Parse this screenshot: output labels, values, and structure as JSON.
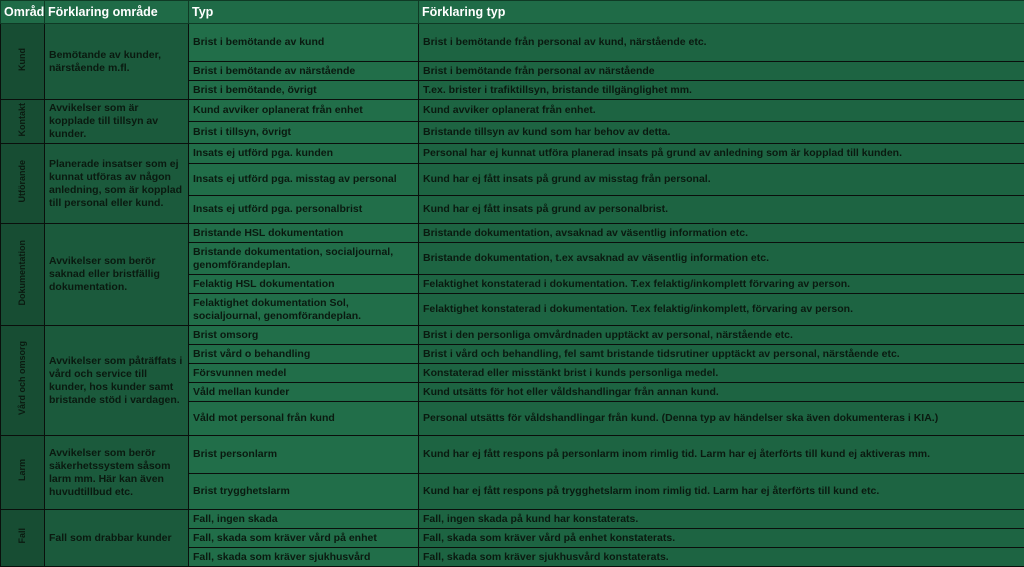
{
  "headers": {
    "omrade": "Område",
    "forklaring_omrade": "Förklaring område",
    "typ": "Typ",
    "forklaring_typ": "Förklaring typ"
  },
  "groups": [
    {
      "area": "Kund",
      "explanation": "Bemötande av kunder, närstående m.fl.",
      "rows": [
        {
          "typ": "Brist i bemötande av kund",
          "forklaring": "Brist i bemötande från personal av kund, närstående etc."
        },
        {
          "typ": "Brist i bemötande av närstående",
          "forklaring": "Brist i bemötande från personal av närstående"
        },
        {
          "typ": "Brist i bemötande, övrigt",
          "forklaring": "T.ex. brister i trafiktillsyn, bristande tillgänglighet mm."
        }
      ]
    },
    {
      "area": "Kontakt",
      "explanation": "Avvikelser som är kopplade till tillsyn av kunder.",
      "rows": [
        {
          "typ": "Kund avviker oplanerat från enhet",
          "forklaring": "Kund avviker oplanerat från enhet."
        },
        {
          "typ": "Brist i tillsyn, övrigt",
          "forklaring": "Bristande tillsyn av kund som har behov av detta."
        }
      ]
    },
    {
      "area": "Utförande",
      "explanation": "Planerade insatser som ej kunnat utföras av någon anledning, som är kopplad till personal eller kund.",
      "rows": [
        {
          "typ": "Insats ej utförd pga. kunden",
          "forklaring": "Personal har ej kunnat utföra planerad insats på grund av anledning som är kopplad till kunden."
        },
        {
          "typ": "Insats ej utförd pga. misstag av personal",
          "forklaring": "Kund har ej fått insats på grund av misstag från personal."
        },
        {
          "typ": "Insats ej utförd pga. personalbrist",
          "forklaring": "Kund har ej fått insats på grund av personalbrist."
        }
      ]
    },
    {
      "area": "Dokumentation",
      "explanation": "Avvikelser som berör saknad eller bristfällig dokumentation.",
      "rows": [
        {
          "typ": "Bristande HSL dokumentation",
          "forklaring": "Bristande dokumentation, avsaknad av väsentlig information etc."
        },
        {
          "typ": "Bristande dokumentation, socialjournal, genomförandeplan.",
          "forklaring": "Bristande dokumentation, t.ex avsaknad av väsentlig information etc."
        },
        {
          "typ": "Felaktig HSL dokumentation",
          "forklaring": "Felaktighet konstaterad i dokumentation. T.ex felaktig/inkomplett förvaring av person."
        },
        {
          "typ": "Felaktighet dokumentation Sol, socialjournal, genomförandeplan.",
          "forklaring": "Felaktighet konstaterad i dokumentation. T.ex felaktig/inkomplett, förvaring av person."
        }
      ]
    },
    {
      "area": "Vård och omsorg",
      "explanation": "Avvikelser som påträffats i vård och service till kunder, hos kunder samt bristande stöd i vardagen.",
      "rows": [
        {
          "typ": "Brist omsorg",
          "forklaring": "Brist i den personliga omvårdnaden upptäckt av personal, närstående etc."
        },
        {
          "typ": "Brist vård o behandling",
          "forklaring": "Brist i vård och behandling, fel samt bristande tidsrutiner upptäckt av personal, närstående etc."
        },
        {
          "typ": "Försvunnen medel",
          "forklaring": "Konstaterad eller misstänkt brist i kunds personliga medel."
        },
        {
          "typ": "Våld mellan kunder",
          "forklaring": "Kund utsätts för hot eller våldshandlingar från annan kund."
        },
        {
          "typ": "Våld mot personal från kund",
          "forklaring": "Personal utsätts för våldshandlingar från kund. (Denna typ av händelser ska även dokumenteras i KIA.)"
        }
      ]
    },
    {
      "area": "Larm",
      "explanation": "Avvikelser som berör säkerhetssystem såsom larm mm. Här kan även huvudtillbud etc.",
      "rows": [
        {
          "typ": "Brist personlarm",
          "forklaring": "Kund har ej fått respons på personlarm inom rimlig tid. Larm har ej återförts till kund ej aktiveras mm."
        },
        {
          "typ": "Brist trygghetslarm",
          "forklaring": "Kund har ej fått respons på trygghetslarm inom rimlig tid. Larm har ej återförts till kund etc."
        }
      ]
    },
    {
      "area": "Fall",
      "explanation": "Fall som drabbar kunder",
      "rows": [
        {
          "typ": "Fall, ingen skada",
          "forklaring": "Fall, ingen skada på kund har konstaterats."
        },
        {
          "typ": "Fall, skada som kräver vård på enhet",
          "forklaring": "Fall, skada som kräver vård på enhet konstaterats."
        },
        {
          "typ": "Fall, skada som kräver sjukhusvård",
          "forklaring": "Fall, skada som kräver sjukhusvård konstaterats."
        }
      ]
    }
  ],
  "colors": {
    "header_bg": "#1f6b47",
    "area_bg": "#174d33",
    "cell_bg": "#216e49",
    "border": "#0a0f0c"
  }
}
